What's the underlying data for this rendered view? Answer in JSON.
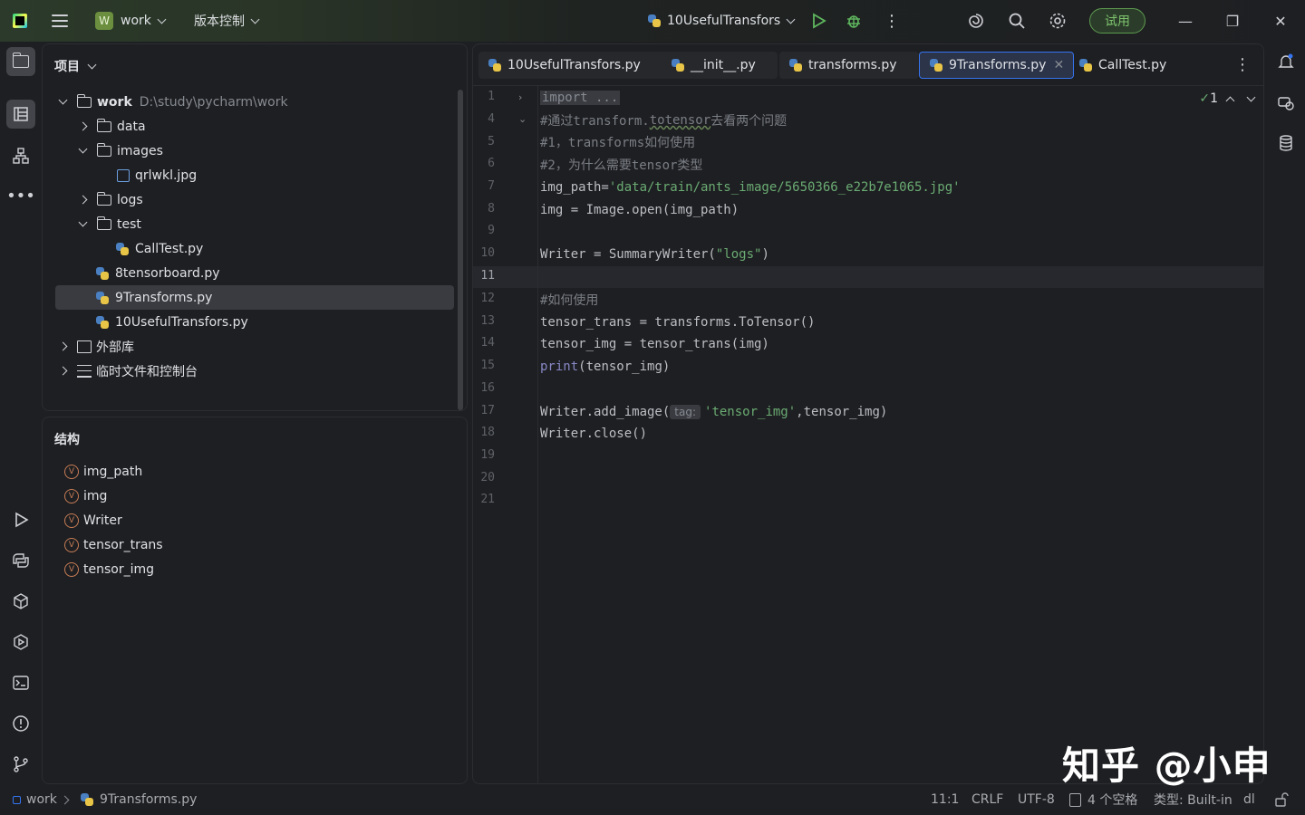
{
  "titlebar": {
    "project_badge": "W",
    "project_name": "work",
    "vcs_menu": "版本控制",
    "run_config": "10UsefulTransfors",
    "trial_label": "试用",
    "minimize": "—",
    "maximize": "❐",
    "close": "✕"
  },
  "project_panel": {
    "title": "项目",
    "tree": [
      {
        "label": "work",
        "hint": "D:\\study\\pycharm\\work",
        "type": "root"
      },
      {
        "label": "data",
        "type": "folder"
      },
      {
        "label": "images",
        "type": "folder"
      },
      {
        "label": "qrlwkl.jpg",
        "type": "image"
      },
      {
        "label": "logs",
        "type": "folder"
      },
      {
        "label": "test",
        "type": "folder"
      },
      {
        "label": "CallTest.py",
        "type": "py"
      },
      {
        "label": "8tensorboard.py",
        "type": "py"
      },
      {
        "label": "9Transforms.py",
        "type": "py"
      },
      {
        "label": "10UsefulTransfors.py",
        "type": "py"
      },
      {
        "label": "外部库",
        "type": "lib"
      },
      {
        "label": "临时文件和控制台",
        "type": "scratch"
      }
    ]
  },
  "structure_panel": {
    "title": "结构",
    "var_badge": "V",
    "items": [
      "img_path",
      "img",
      "Writer",
      "tensor_trans",
      "tensor_img"
    ]
  },
  "editor": {
    "tabs": [
      "10UsefulTransfors.py",
      "__init__.py",
      "transforms.py",
      "9Transforms.py",
      "CallTest.py"
    ],
    "active_tab": "9Transforms.py",
    "inspection_count": "1",
    "line_numbers": [
      "1",
      "4",
      "5",
      "6",
      "7",
      "8",
      "9",
      "10",
      "11",
      "12",
      "13",
      "14",
      "15",
      "16",
      "17",
      "18",
      "19",
      "20",
      "21"
    ],
    "code": {
      "l1": "import ...",
      "l4a": "#通过transform.",
      "l4b": "totensor",
      "l4c": "去看两个问题",
      "l5": "#1，transforms如何使用",
      "l6": "#2，为什么需要tensor类型",
      "l7a": "img_path=",
      "l7b": "'data/train/ants_image/5650366_e22b7e1065.jpg'",
      "l8": "img = Image.open(img_path)",
      "l10a": "Writer = SummaryWriter(",
      "l10b": "\"logs\"",
      "l10c": ")",
      "l12": "#如何使用",
      "l13": "tensor_trans = transforms.ToTensor()",
      "l14": "tensor_img = tensor_trans(img)",
      "l15a": "print",
      "l15b": "(tensor_img)",
      "l17a": "Writer.add_image(",
      "l17tag": "tag:",
      "l17b": "'tensor_img'",
      "l17c": ",tensor_img)",
      "l18": "Writer.close()"
    }
  },
  "statusbar": {
    "project": "work",
    "file": "9Transforms.py",
    "position": "11:1",
    "line_sep": "CRLF",
    "encoding": "UTF-8",
    "indent": "4 个空格",
    "interpreter": "类型: Built-in",
    "extra": "dl"
  },
  "watermark": "知乎 @小申"
}
